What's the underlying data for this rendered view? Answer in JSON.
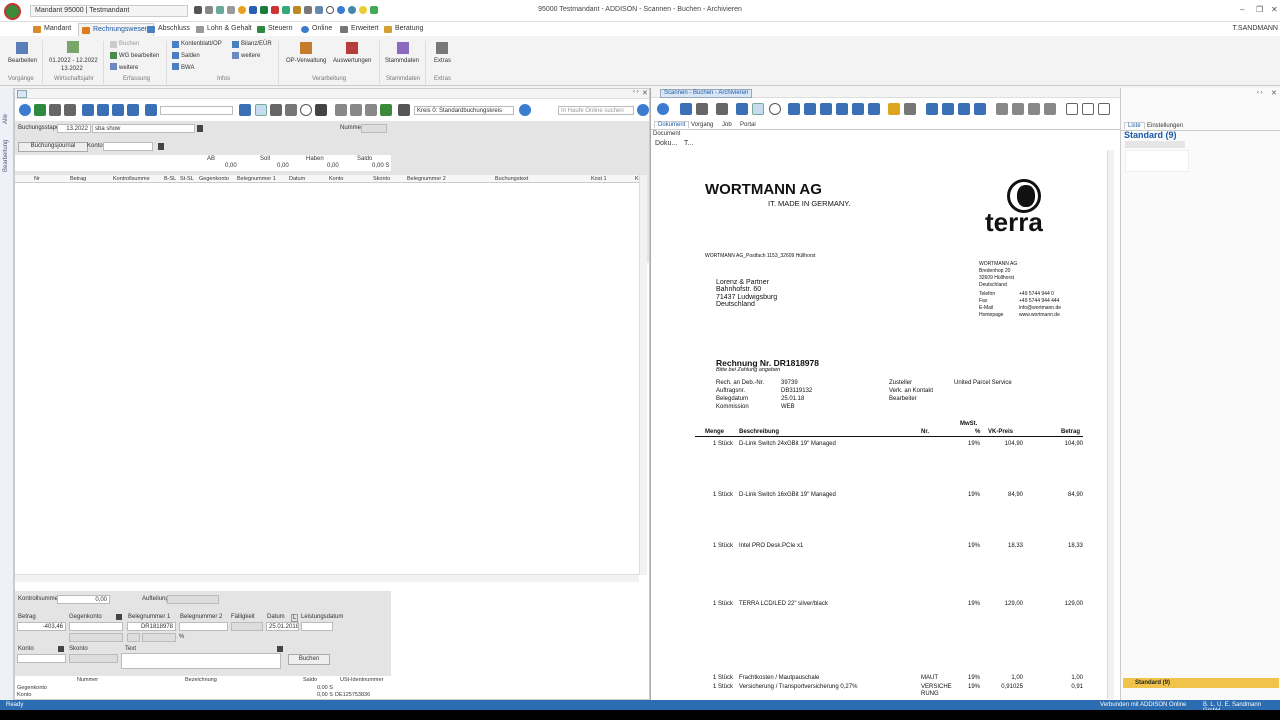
{
  "titlebar": {
    "mandant": "Mandant 95000  |  Testmandant",
    "window_title": "95000 Testmandant - ADDISON - Scannen - Buchen - Archivieren",
    "user": "T.SANDMANN"
  },
  "ribbon_tabs": [
    "Mandant",
    "Rechnungswesen",
    "Abschluss",
    "Lohn & Gehalt",
    "Steuern",
    "Online",
    "Erweitert",
    "Beratung"
  ],
  "ribbon": {
    "bearbeiten": "Bearbeiten",
    "period_range": "01.2022 - 12.2022",
    "period_current": "13.2022",
    "buchen": "Buchen",
    "wg_bearbeiten": "WG bearbeiten",
    "weitere": "weitere",
    "kontenblatt": "Kontenblatt/OP",
    "salden": "Salden",
    "bwa": "BWA",
    "bilanz": "Bilanz/EÜR",
    "weitere2": "weitere",
    "op_verwaltung": "OP-Verwaltung",
    "auswertungen": "Auswertungen",
    "stammdaten": "Stammdaten",
    "extras": "Extras",
    "groups": {
      "vorgaenge": "Vorgänge",
      "wirtschaftsjahr": "Wirtschaftsjahr",
      "erfassung": "Erfassung",
      "infos": "Infos",
      "verarbeitung": "Verarbeitung",
      "stammdaten": "Stammdaten",
      "extras": "Extras"
    }
  },
  "sidebar": {
    "alle": "Alle",
    "bearbeitung": "Bearbeitung"
  },
  "left": {
    "kreis": "Kreis 0: Standardbuchungskreis",
    "search_placeholder": "In Haufe Online suchen",
    "buchungsstapel_label": "Buchungsstapel",
    "buchungsstapel_period": "13.2022",
    "buchungsstapel_name": "sba show",
    "nummer_label": "Nummer",
    "buchungsjournal": "Buchungsjournal",
    "konto_label": "Konto",
    "totals_headers": [
      "AB",
      "Soll",
      "Haben",
      "Saldo"
    ],
    "totals_values": [
      "0,00",
      "0,00",
      "0,00",
      "0,00 S"
    ],
    "grid_headers": [
      "Nr",
      "Betrag",
      "Kontrollsumme",
      "B-SL",
      "St-SL",
      "Gegenkonto",
      "Belegnummer 1",
      "Datum",
      "Konto",
      "Skonto",
      "Belegnummer 2",
      "Buchungstext",
      "Kost 1",
      "K"
    ]
  },
  "entry": {
    "kontrollsumme_label": "Kontrollsumme",
    "kontrollsumme_value": "0,00",
    "aufteilung_label": "Aufteilung",
    "betrag_label": "Betrag",
    "gegenkonto_label": "Gegenkonto",
    "beleg1_label": "Belegnummer 1",
    "beleg2_label": "Belegnummer 2",
    "faelligkeit_label": "Fälligkeit",
    "datum_label": "Datum",
    "leistungsdatum_label": "Leistungsdatum",
    "betrag_value": "-403,46",
    "beleg1_value": "DR1818978",
    "datum_value": "25.01.2018",
    "percent": "%",
    "konto_label": "Konto",
    "skonto_label": "Skonto",
    "text_label": "Text",
    "buchen_button": "Buchen",
    "table_headers": [
      "Nummer",
      "Bezeichnung",
      "Saldo",
      "USt-Identnummer"
    ],
    "rows": [
      {
        "label": "Gegenkonto",
        "saldo": "0,00 S",
        "ust": ""
      },
      {
        "label": "Konto",
        "saldo": "0,00 S",
        "ust": "DE125753836"
      }
    ]
  },
  "right": {
    "tab_title": "Scannen - Buchen - Archivieren",
    "subtabs": [
      "Dokument",
      "Vorgang",
      "Job",
      "Portal"
    ],
    "document_label": "Document",
    "doku_label": "Doku...",
    "t_label": "T..."
  },
  "invoice": {
    "company": "WORTMANN AG",
    "slogan": "IT. MADE IN GERMANY.",
    "brand": "terra",
    "sender_line": "WORTMANN AG_Postfach 1153_32609 Hüllhorst",
    "recipient": [
      "Lorenz & Partner",
      "Bahnhofstr. 60",
      "71437 Ludwigsburg",
      "Deutschland"
    ],
    "company_block": [
      "WORTMANN AG",
      "Bredenhop 20",
      "32609 Hüllhorst",
      "Deutschland"
    ],
    "contact_labels": [
      "Telefon",
      "Fax",
      "E-Mail",
      "Homepage"
    ],
    "contact_values": [
      "+49 5744 944 0",
      "+49 5744 944 444",
      "info@wortmann.de",
      "www.wortmann.de"
    ],
    "title": "Rechnung Nr. DR1818978",
    "subtitle": "Bitte bei Zahlung angeben",
    "meta_labels": [
      "Rech. an Deb.-Nr.",
      "Auftragsnr.",
      "Belegdatum",
      "Kommission"
    ],
    "meta_values": [
      "39739",
      "DB3119132",
      "25.01.18",
      "WEB"
    ],
    "meta2_labels": [
      "Zusteller",
      "Verk. an Kontakt",
      "Bearbeiter"
    ],
    "meta2_values": [
      "United Parcel Service",
      "",
      ""
    ],
    "col_headers": [
      "Menge",
      "Beschreibung",
      "Nr.",
      "MwSt.",
      "%",
      "VK-Preis",
      "Betrag"
    ],
    "items": [
      {
        "menge": "1 Stück",
        "desc": "D-Link Switch 24xGBit 19\" Managed",
        "nr": "",
        "mwst": "19%",
        "vk": "104,90",
        "betrag": "104,90"
      },
      {
        "menge": "1 Stück",
        "desc": "D-Link Switch 16xGBit 19\" Managed",
        "nr": "",
        "mwst": "19%",
        "vk": "84,90",
        "betrag": "84,90"
      },
      {
        "menge": "1 Stück",
        "desc": "Intel PRO Desk.PCIe x1",
        "nr": "",
        "mwst": "19%",
        "vk": "18,33",
        "betrag": "18,33"
      },
      {
        "menge": "1 Stück",
        "desc": "TERRA LCD/LED 22\" silver/black",
        "nr": "",
        "mwst": "19%",
        "vk": "129,00",
        "betrag": "129,00"
      },
      {
        "menge": "1 Stück",
        "desc": "Frachtkosten / Mautpauschale",
        "nr": "MAUT",
        "mwst": "19%",
        "vk": "1,00",
        "betrag": "1,00"
      },
      {
        "menge": "1 Stück",
        "desc": "Versicherung / Transportversicherung 0,27%",
        "nr": "VERSICHE RUNG",
        "mwst": "19%",
        "vk": "0,91025",
        "betrag": "0,91"
      }
    ]
  },
  "farright": {
    "tabs": [
      "Liste",
      "Einstellungen"
    ],
    "title": "Standard (9)",
    "footer": "Standard (9)"
  },
  "status": {
    "left": "Ready",
    "connected": "Verbunden mit ADDISON Online",
    "company": "B. L. U. E. Sandmann GmbH"
  }
}
